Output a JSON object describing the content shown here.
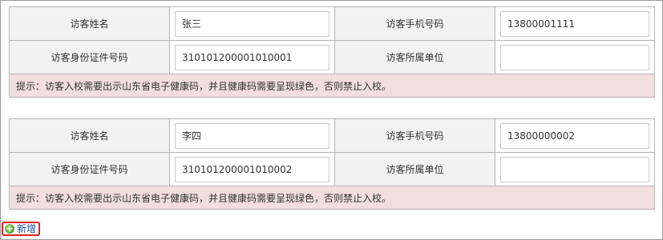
{
  "visitors": [
    {
      "name_label": "访客姓名",
      "name_value": "张三",
      "phone_label": "访客手机号码",
      "phone_value": "13800001111",
      "id_label": "访客身份证件号码",
      "id_value": "310101200001010001",
      "org_label": "访客所属单位",
      "org_value": "",
      "tip": "提示：访客入校需要出示山东省电子健康码，并且健康码需要呈现绿色，否则禁止入校。"
    },
    {
      "name_label": "访客姓名",
      "name_value": "李四",
      "phone_label": "访客手机号码",
      "phone_value": "13800000002",
      "id_label": "访客身份证件号码",
      "id_value": "310101200001010002",
      "org_label": "访客所属单位",
      "org_value": "",
      "tip": "提示：访客入校需要出示山东省电子健康码，并且健康码需要呈现绿色，否则禁止入校。"
    }
  ],
  "add_button": {
    "label": "新增",
    "icon": "plus-circle-icon"
  },
  "colors": {
    "label_bg": "#f2f2f2",
    "tip_bg": "#f2dedf",
    "border": "#b5b5b5",
    "add_highlight": "#e02020",
    "add_text": "#1a4fa0"
  }
}
